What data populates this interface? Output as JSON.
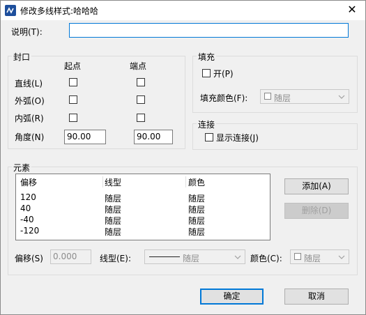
{
  "window": {
    "title": "修改多线样式:哈哈哈",
    "close_glyph": "✕"
  },
  "description": {
    "label": "说明(T):",
    "value": ""
  },
  "caps": {
    "group_label": "封口",
    "col_start": "起点",
    "col_end": "端点",
    "rows": [
      {
        "label": "直线(L)"
      },
      {
        "label": "外弧(O)"
      },
      {
        "label": "内弧(R)"
      }
    ],
    "angle_label": "角度(N)",
    "angle_start": "90.00",
    "angle_end": "90.00"
  },
  "fill": {
    "group_label": "填充",
    "on_label": "开(P)",
    "color_label": "填充颜色(F):",
    "color_value": "随层"
  },
  "joints": {
    "group_label": "连接",
    "show_label": "显示连接(J)"
  },
  "elements": {
    "group_label": "元素",
    "columns": [
      "偏移",
      "线型",
      "颜色"
    ],
    "rows": [
      {
        "offset": "120",
        "linetype": "随层",
        "color": "随层"
      },
      {
        "offset": "40",
        "linetype": "随层",
        "color": "随层"
      },
      {
        "offset": "-40",
        "linetype": "随层",
        "color": "随层"
      },
      {
        "offset": "-120",
        "linetype": "随层",
        "color": "随层"
      }
    ],
    "add_label": "添加(A)",
    "delete_label": "删除(D)",
    "offset_label": "偏移(S)",
    "offset_value": "0.000",
    "linetype_label": "线型(E):",
    "linetype_value": "随层",
    "color_label": "颜色(C):",
    "color_value": "随层"
  },
  "buttons": {
    "ok": "确定",
    "cancel": "取消"
  },
  "colors": {
    "accent": "#0078d7",
    "app_icon": "#1e4f9c"
  }
}
